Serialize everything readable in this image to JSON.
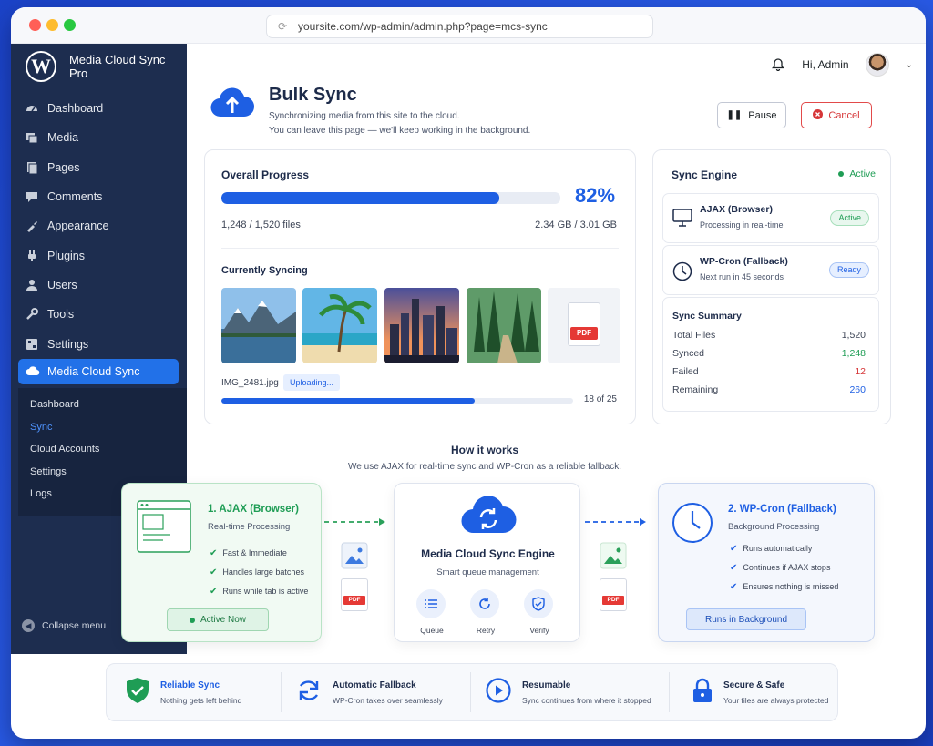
{
  "browser": {
    "url": "yoursite.com/wp-admin/admin.php?page=mcs-sync"
  },
  "sidebar": {
    "brand": "Media Cloud Sync Pro",
    "items": [
      {
        "label": "Dashboard",
        "icon": "dashboard-icon"
      },
      {
        "label": "Media",
        "icon": "media-icon"
      },
      {
        "label": "Pages",
        "icon": "pages-icon"
      },
      {
        "label": "Comments",
        "icon": "comments-icon"
      },
      {
        "label": "Appearance",
        "icon": "appearance-icon"
      },
      {
        "label": "Plugins",
        "icon": "plugins-icon"
      },
      {
        "label": "Users",
        "icon": "users-icon"
      },
      {
        "label": "Tools",
        "icon": "tools-icon"
      },
      {
        "label": "Settings",
        "icon": "settings-icon"
      }
    ],
    "active": "Media Cloud Sync",
    "sub": [
      "Dashboard",
      "Sync",
      "Cloud Accounts",
      "Settings",
      "Logs"
    ],
    "collapse": "Collapse menu"
  },
  "topbar": {
    "greeting": "Hi, Admin"
  },
  "header": {
    "title": "Bulk Sync",
    "subtitle1": "Synchronizing media from this site to the cloud.",
    "subtitle2": "You can leave this page — we'll keep working in the background.",
    "pause": "Pause",
    "cancel": "Cancel"
  },
  "progress": {
    "title": "Overall Progress",
    "percent": "82%",
    "percent_value": 82,
    "files": "1,248 / 1,520 files",
    "size": "2.34 GB / 3.01 GB",
    "current_title": "Currently Syncing",
    "current_file": "IMG_2481.jpg",
    "uploading": "Uploading...",
    "batch": "18 of 25",
    "batch_value": 0.72,
    "pdf": "PDF"
  },
  "engine": {
    "title": "Sync Engine",
    "status": "Active",
    "ajax_title": "AJAX (Browser)",
    "ajax_sub": "Processing in real-time",
    "ajax_pill": "Active",
    "cron_title": "WP-Cron (Fallback)",
    "cron_sub": "Next run in 45 seconds",
    "cron_pill": "Ready",
    "summary_title": "Sync Summary",
    "summary": [
      {
        "label": "Total Files",
        "value": "1,520",
        "color": "#1d2b4a"
      },
      {
        "label": "Synced",
        "value": "1,248",
        "color": "#1f9d55"
      },
      {
        "label": "Failed",
        "value": "12",
        "color": "#d63638"
      },
      {
        "label": "Remaining",
        "value": "260",
        "color": "#1e5fe3"
      }
    ]
  },
  "how": {
    "title": "How it works",
    "subtitle": "We use AJAX for real-time sync and WP-Cron as a reliable fallback.",
    "ajax": {
      "title": "1. AJAX (Browser)",
      "sub": "Real-time Processing",
      "points": [
        "Fast & Immediate",
        "Handles large batches",
        "Runs while tab is active"
      ],
      "button": "Active Now"
    },
    "engine": {
      "title": "Media Cloud Sync Engine",
      "sub": "Smart queue management",
      "actions": [
        "Queue",
        "Retry",
        "Verify"
      ]
    },
    "cron": {
      "title": "2. WP-Cron (Fallback)",
      "sub": "Background Processing",
      "points": [
        "Runs automatically",
        "Continues if AJAX stops",
        "Ensures nothing is missed"
      ],
      "button": "Runs in Background"
    }
  },
  "features": [
    {
      "title": "Reliable Sync",
      "sub": "Nothing gets left behind",
      "icon": "shield-check-icon"
    },
    {
      "title": "Automatic Fallback",
      "sub": "WP-Cron takes over seamlessly",
      "icon": "refresh-icon"
    },
    {
      "title": "Resumable",
      "sub": "Sync continues from where it stopped",
      "icon": "play-circle-icon"
    },
    {
      "title": "Secure & Safe",
      "sub": "Your files are always protected",
      "icon": "lock-icon"
    }
  ]
}
